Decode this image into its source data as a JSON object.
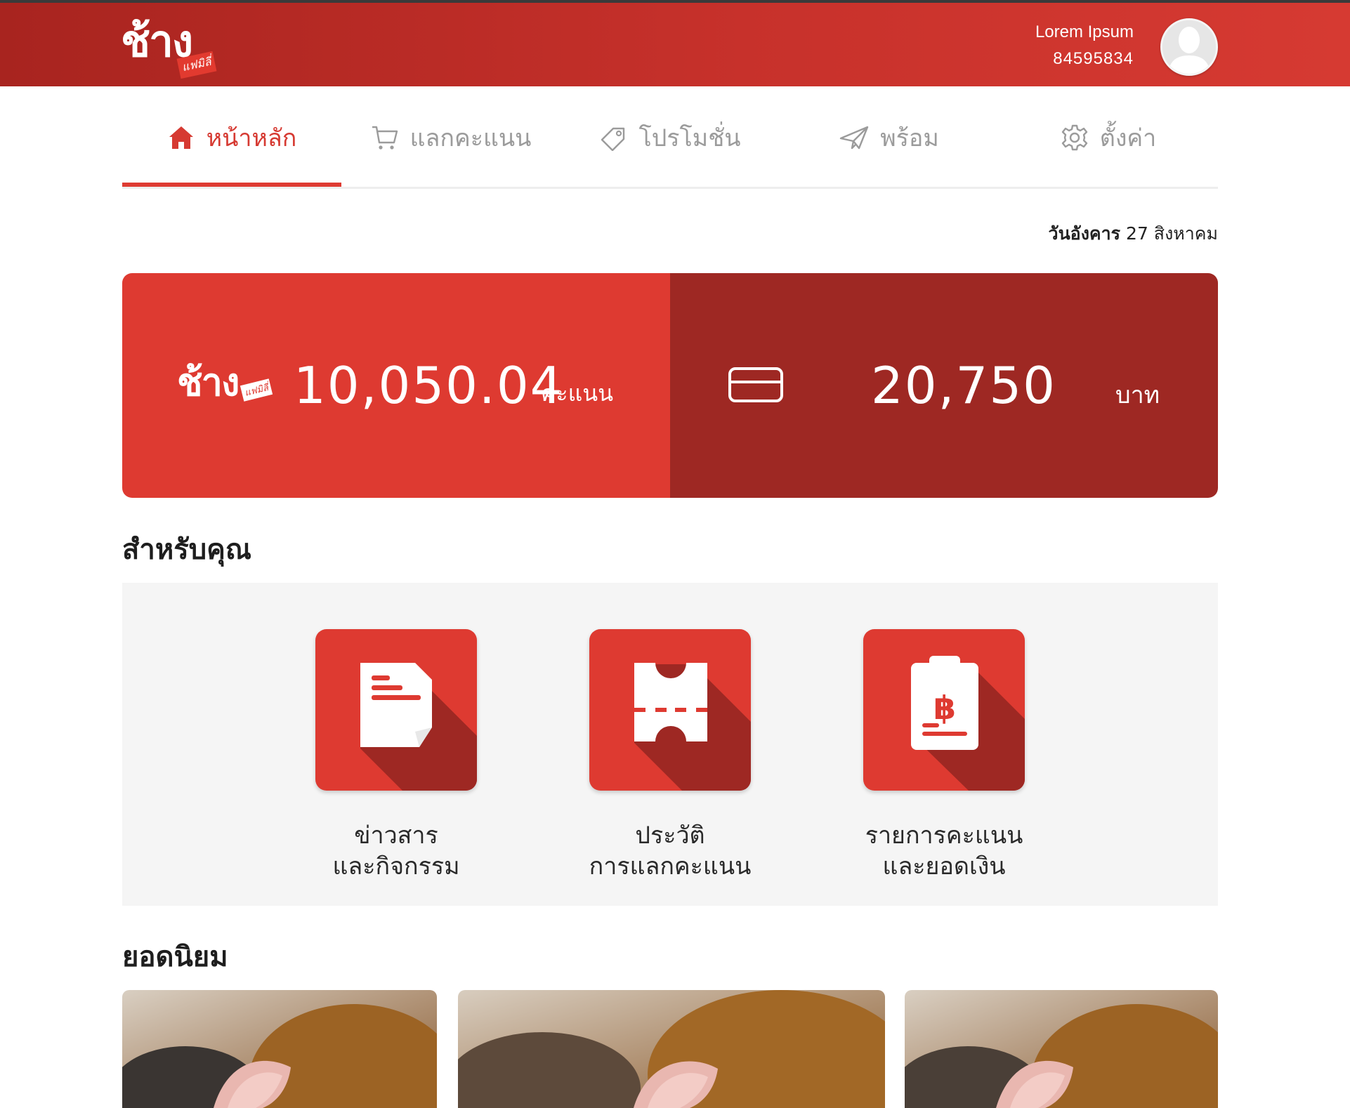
{
  "header": {
    "logo": {
      "main": "ช้าง",
      "sub": "แฟมิลี่"
    },
    "user_name": "Lorem Ipsum",
    "user_id": "84595834"
  },
  "tabs": [
    {
      "label": "หน้าหลัก",
      "icon": "home-icon",
      "active": true
    },
    {
      "label": "แลกคะแนน",
      "icon": "cart-icon",
      "active": false
    },
    {
      "label": "โปรโมชั่น",
      "icon": "tag-icon",
      "active": false
    },
    {
      "label": "พร้อม",
      "icon": "paper-plane-icon",
      "active": false
    },
    {
      "label": "ตั้งค่า",
      "icon": "gear-icon",
      "active": false
    }
  ],
  "date": {
    "weekday": "วันอังคาร",
    "rest": "27 สิงหาคม"
  },
  "balance": {
    "points_value": "10,050.04",
    "points_unit": "คะแนน",
    "money_value": "20,750",
    "money_unit": "บาท"
  },
  "for_you": {
    "title": "สำหรับคุณ",
    "items": [
      {
        "line1": "ข่าวสาร",
        "line2": "และกิจกรรม",
        "icon": "news-document-icon"
      },
      {
        "line1": "ประวัติ",
        "line2": "การแลกคะแนน",
        "icon": "ticket-icon"
      },
      {
        "line1": "รายการคะแนน",
        "line2": "และยอดเงิน",
        "icon": "baht-clipboard-icon"
      }
    ]
  },
  "popular": {
    "title": "ยอดนิยม"
  },
  "colors": {
    "primary_red": "#de3a31",
    "dark_red": "#9e2823",
    "header_red": "#c7312b",
    "inactive_tab": "#9b9b9b"
  }
}
